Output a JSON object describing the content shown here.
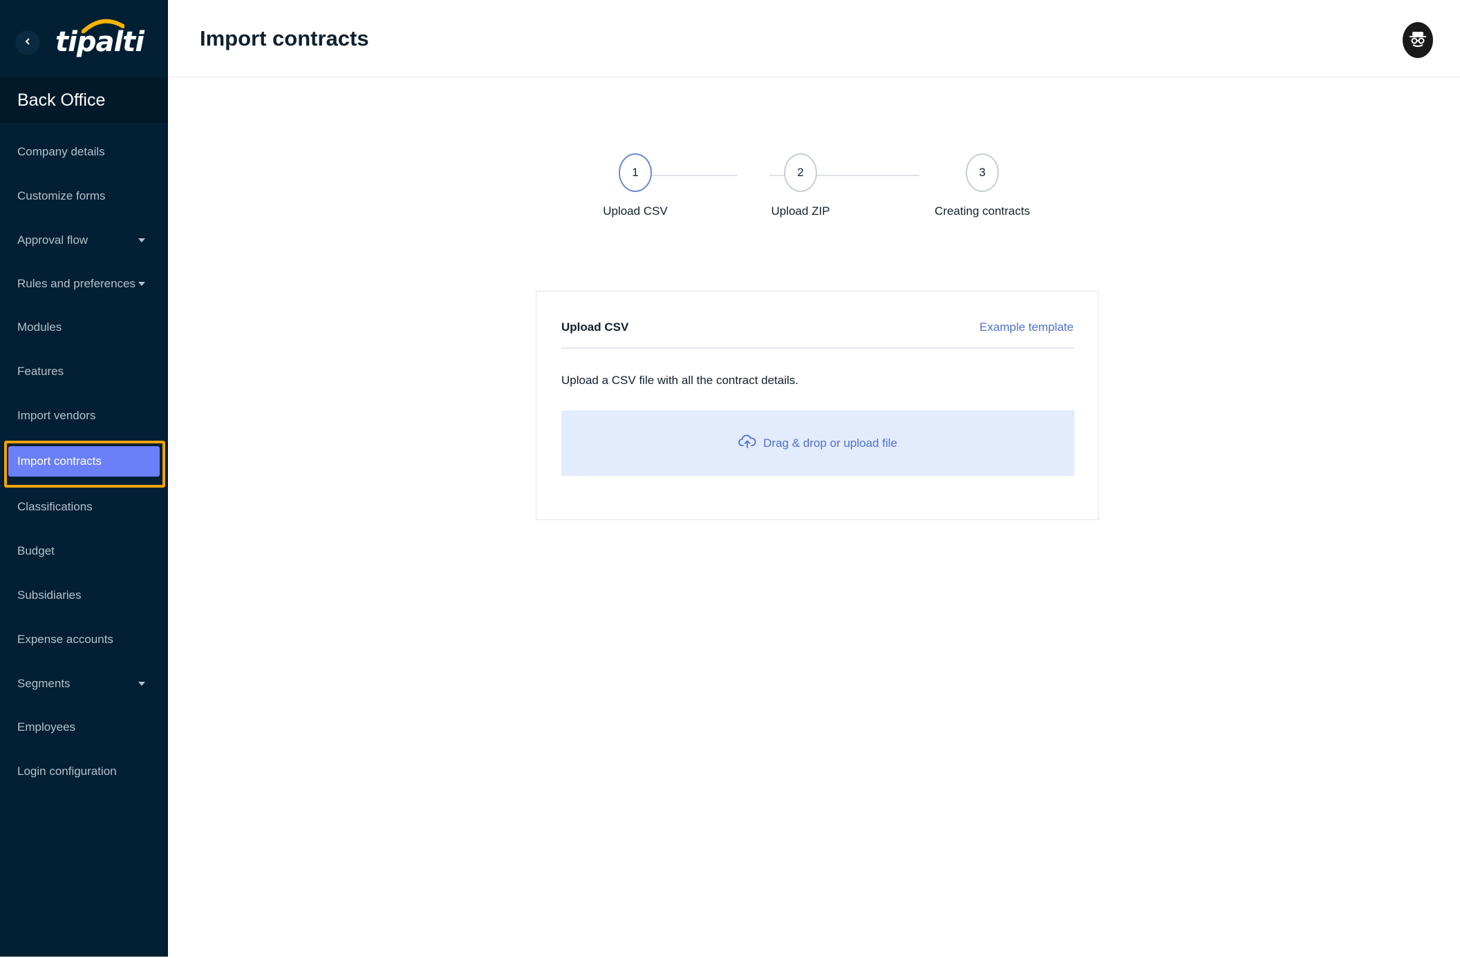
{
  "sidebar": {
    "logo_text": "tipalti",
    "section_title": "Back Office",
    "items": [
      {
        "label": "Company details"
      },
      {
        "label": "Customize forms"
      },
      {
        "label": "Approval flow"
      },
      {
        "label": "Rules and preferences"
      },
      {
        "label": "Modules"
      },
      {
        "label": "Features"
      },
      {
        "label": "Import vendors"
      },
      {
        "label": "Import contracts"
      },
      {
        "label": "Classifications"
      },
      {
        "label": "Budget"
      },
      {
        "label": "Subsidiaries"
      },
      {
        "label": "Expense accounts"
      },
      {
        "label": "Segments"
      },
      {
        "label": "Employees"
      },
      {
        "label": "Login configuration"
      }
    ],
    "active_item": "Import contracts"
  },
  "header": {
    "title": "Import contracts"
  },
  "stepper": {
    "steps": [
      {
        "number": "1",
        "label": "Upload CSV"
      },
      {
        "number": "2",
        "label": "Upload ZIP"
      },
      {
        "number": "3",
        "label": "Creating contracts"
      }
    ],
    "current_step": 1
  },
  "card": {
    "title": "Upload CSV",
    "template_link": "Example template",
    "description": "Upload a CSV file with all the contract details.",
    "dropzone_label": "Drag & drop or upload file"
  },
  "colors": {
    "sidebar_bg": "#031f33",
    "active_item_bg": "#6b7ff8",
    "highlight_border": "#f5a200",
    "link": "#4f6fd4",
    "dropzone_bg": "#e3ecfd",
    "logo_accent": "#f5b400"
  },
  "icons": {
    "back": "chevron-left-icon",
    "upload": "cloud-upload-icon",
    "avatar": "incognito-avatar-icon",
    "caret": "caret-down-icon"
  }
}
